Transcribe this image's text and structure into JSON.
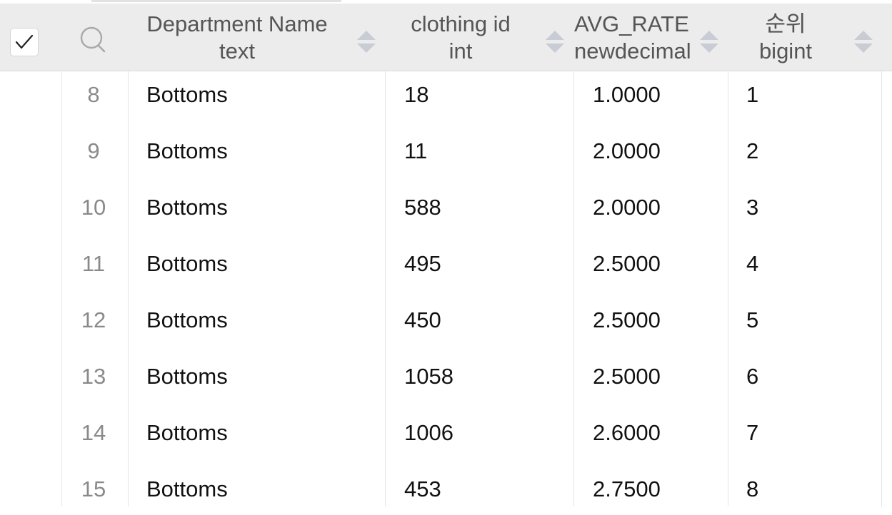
{
  "header": {
    "columns": [
      {
        "name": "Department Name",
        "type": "text"
      },
      {
        "name": "clothing id",
        "type": "int"
      },
      {
        "name": "AVG_RATE",
        "type": "newdecimal"
      },
      {
        "name": "순위",
        "type": "bigint"
      }
    ]
  },
  "rows": [
    {
      "num": "8",
      "department": "Bottoms",
      "clothing_id": "18",
      "avg_rate": "1.0000",
      "rank": "1"
    },
    {
      "num": "9",
      "department": "Bottoms",
      "clothing_id": "11",
      "avg_rate": "2.0000",
      "rank": "2"
    },
    {
      "num": "10",
      "department": "Bottoms",
      "clothing_id": "588",
      "avg_rate": "2.0000",
      "rank": "3"
    },
    {
      "num": "11",
      "department": "Bottoms",
      "clothing_id": "495",
      "avg_rate": "2.5000",
      "rank": "4"
    },
    {
      "num": "12",
      "department": "Bottoms",
      "clothing_id": "450",
      "avg_rate": "2.5000",
      "rank": "5"
    },
    {
      "num": "13",
      "department": "Bottoms",
      "clothing_id": "1058",
      "avg_rate": "2.5000",
      "rank": "6"
    },
    {
      "num": "14",
      "department": "Bottoms",
      "clothing_id": "1006",
      "avg_rate": "2.6000",
      "rank": "7"
    },
    {
      "num": "15",
      "department": "Bottoms",
      "clothing_id": "453",
      "avg_rate": "2.7500",
      "rank": "8"
    }
  ]
}
